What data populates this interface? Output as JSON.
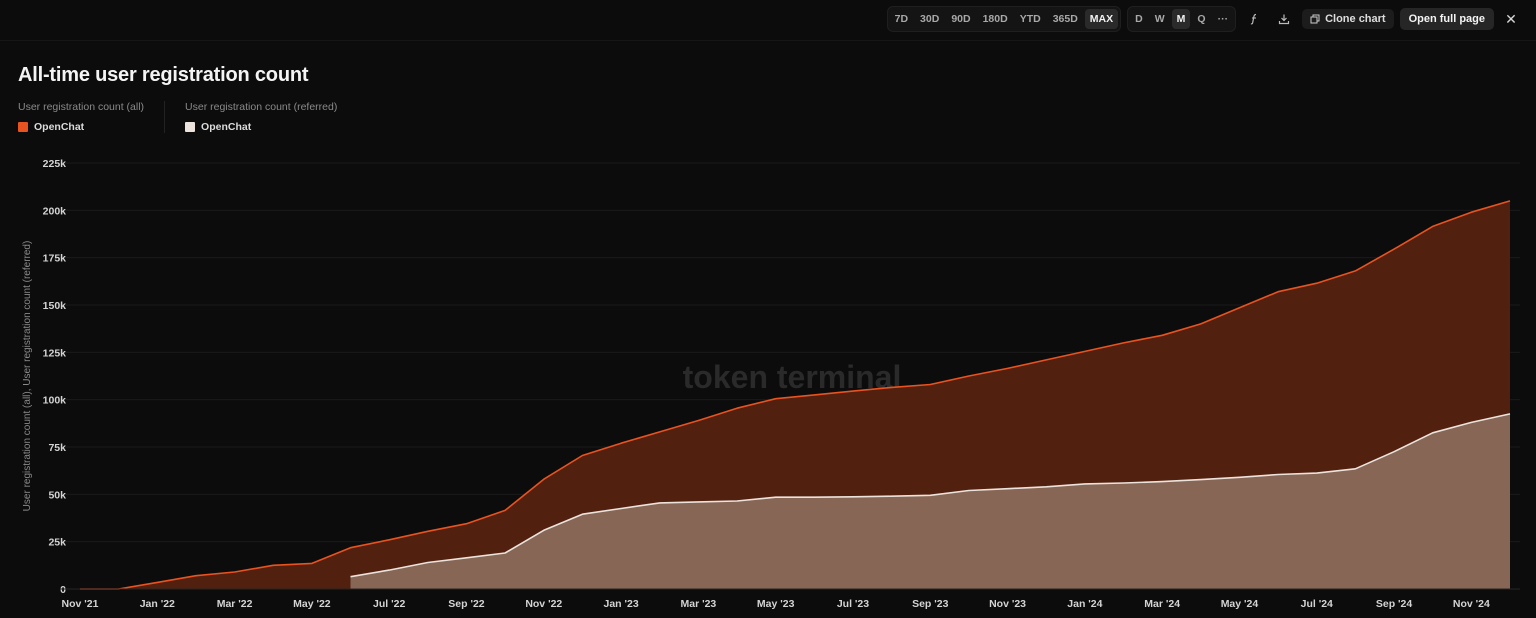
{
  "toolbar": {
    "ranges": [
      "7D",
      "30D",
      "90D",
      "180D",
      "YTD",
      "365D",
      "MAX"
    ],
    "active_range": "MAX",
    "granularity": [
      "D",
      "W",
      "M",
      "Q",
      "···"
    ],
    "active_granularity": "M",
    "clone_label": "Clone chart",
    "open_label": "Open full page"
  },
  "chart_data": {
    "type": "area",
    "title": "All-time user registration count",
    "ylabel": "User registration count (all), User registration count (referred)",
    "ylim": [
      0,
      225000
    ],
    "yticks": [
      0,
      25000,
      50000,
      75000,
      100000,
      125000,
      150000,
      175000,
      200000,
      225000
    ],
    "ytick_labels": [
      "0",
      "25k",
      "50k",
      "75k",
      "100k",
      "125k",
      "150k",
      "175k",
      "200k",
      "225k"
    ],
    "x": [
      "2021-11",
      "2021-12",
      "2022-01",
      "2022-02",
      "2022-03",
      "2022-04",
      "2022-05",
      "2022-06",
      "2022-07",
      "2022-08",
      "2022-09",
      "2022-10",
      "2022-11",
      "2022-12",
      "2023-01",
      "2023-02",
      "2023-03",
      "2023-04",
      "2023-05",
      "2023-06",
      "2023-07",
      "2023-08",
      "2023-09",
      "2023-10",
      "2023-11",
      "2023-12",
      "2024-01",
      "2024-02",
      "2024-03",
      "2024-04",
      "2024-05",
      "2024-06",
      "2024-07",
      "2024-08",
      "2024-09",
      "2024-10",
      "2024-11",
      "2024-12"
    ],
    "xtick_labels": [
      "Nov '21",
      "Jan '22",
      "Mar '22",
      "May '22",
      "Jul '22",
      "Sep '22",
      "Nov '22",
      "Jan '23",
      "Mar '23",
      "May '23",
      "Jul '23",
      "Sep '23",
      "Nov '23",
      "Jan '24",
      "Mar '24",
      "May '24",
      "Jul '24",
      "Sep '24",
      "Nov '24"
    ],
    "legend_groups": [
      {
        "header": "User registration count (all)",
        "label": "OpenChat"
      },
      {
        "header": "User registration count (referred)",
        "label": "OpenChat"
      }
    ],
    "series": [
      {
        "name": "User registration count (all)",
        "legend_label": "OpenChat",
        "color": "#e8531f",
        "fill": "#52200e",
        "values": [
          0,
          0,
          3500,
          7000,
          9000,
          12500,
          13500,
          21800,
          26000,
          30500,
          34500,
          41500,
          58000,
          70500,
          77000,
          83000,
          89000,
          95500,
          100500,
          102500,
          104500,
          106500,
          108000,
          112500,
          116500,
          121000,
          125500,
          130000,
          134000,
          140000,
          148500,
          157000,
          161500,
          168000,
          179500,
          191500,
          199000,
          205000
        ]
      },
      {
        "name": "User registration count (referred)",
        "legend_label": "OpenChat",
        "color": "#ece3dc",
        "fill": "#876656",
        "values": [
          null,
          null,
          null,
          null,
          null,
          null,
          null,
          6500,
          10000,
          14000,
          16500,
          19000,
          31000,
          39500,
          42500,
          45500,
          46000,
          46500,
          48500,
          48500,
          48700,
          49000,
          49500,
          52000,
          53000,
          54000,
          55500,
          56000,
          56700,
          57800,
          59000,
          60500,
          61200,
          63500,
          72500,
          82500,
          88000,
          92500
        ]
      }
    ],
    "watermark": "token terminal",
    "grid": true
  }
}
